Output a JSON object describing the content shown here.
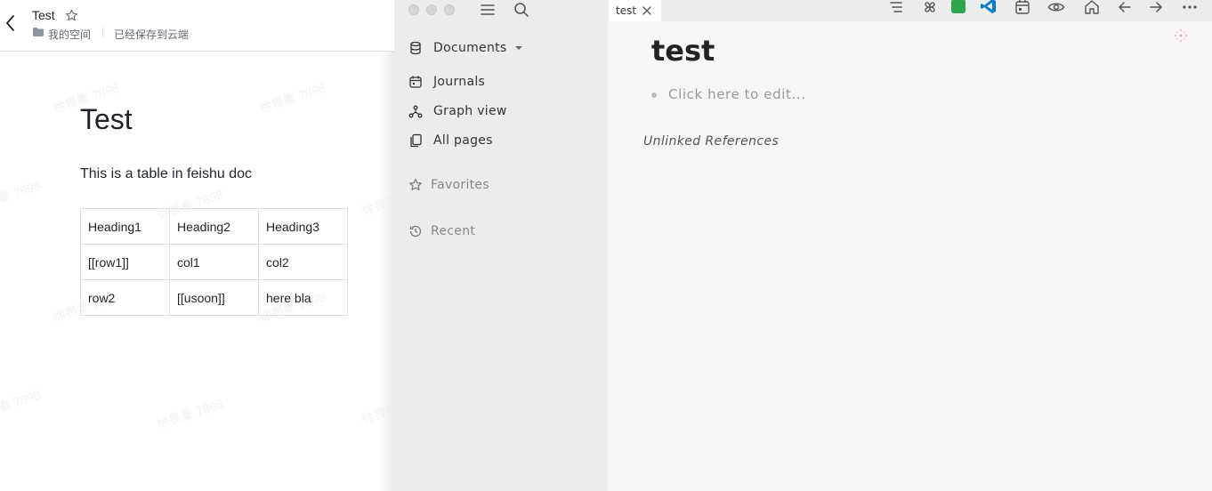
{
  "feishu": {
    "title": "Test",
    "breadcrumb_space": "我的空间",
    "save_status": "已经保存到云端",
    "watermark": "徐畏秦 7898",
    "doc": {
      "title": "Test",
      "paragraph": "This is a table in feishu doc",
      "table": [
        [
          "Heading1",
          "Heading2",
          "Heading3"
        ],
        [
          "[[row1]]",
          "col1",
          "col2"
        ],
        [
          "row2",
          "[[usoon]]",
          "here bla"
        ]
      ]
    }
  },
  "logseq": {
    "sidebar": {
      "documents_label": "Documents",
      "journals_label": "Journals",
      "graph_view_label": "Graph view",
      "all_pages_label": "All pages",
      "favorites_label": "Favorites",
      "recent_label": "Recent"
    },
    "tab": {
      "label": "test"
    },
    "page": {
      "title": "test",
      "placeholder": "Click here to edit...",
      "unlinked_references": "Unlinked References"
    },
    "toolbar_icons": [
      "list-icon",
      "pinwheel-icon",
      "green-square-icon",
      "vscode-icon",
      "calendar-icon",
      "eye-icon",
      "home-icon",
      "arrow-left-icon",
      "arrow-right-icon",
      "more-icon"
    ],
    "colors": {
      "accent_green": "#2ea44f",
      "vscode_blue": "#0a7acc"
    }
  }
}
